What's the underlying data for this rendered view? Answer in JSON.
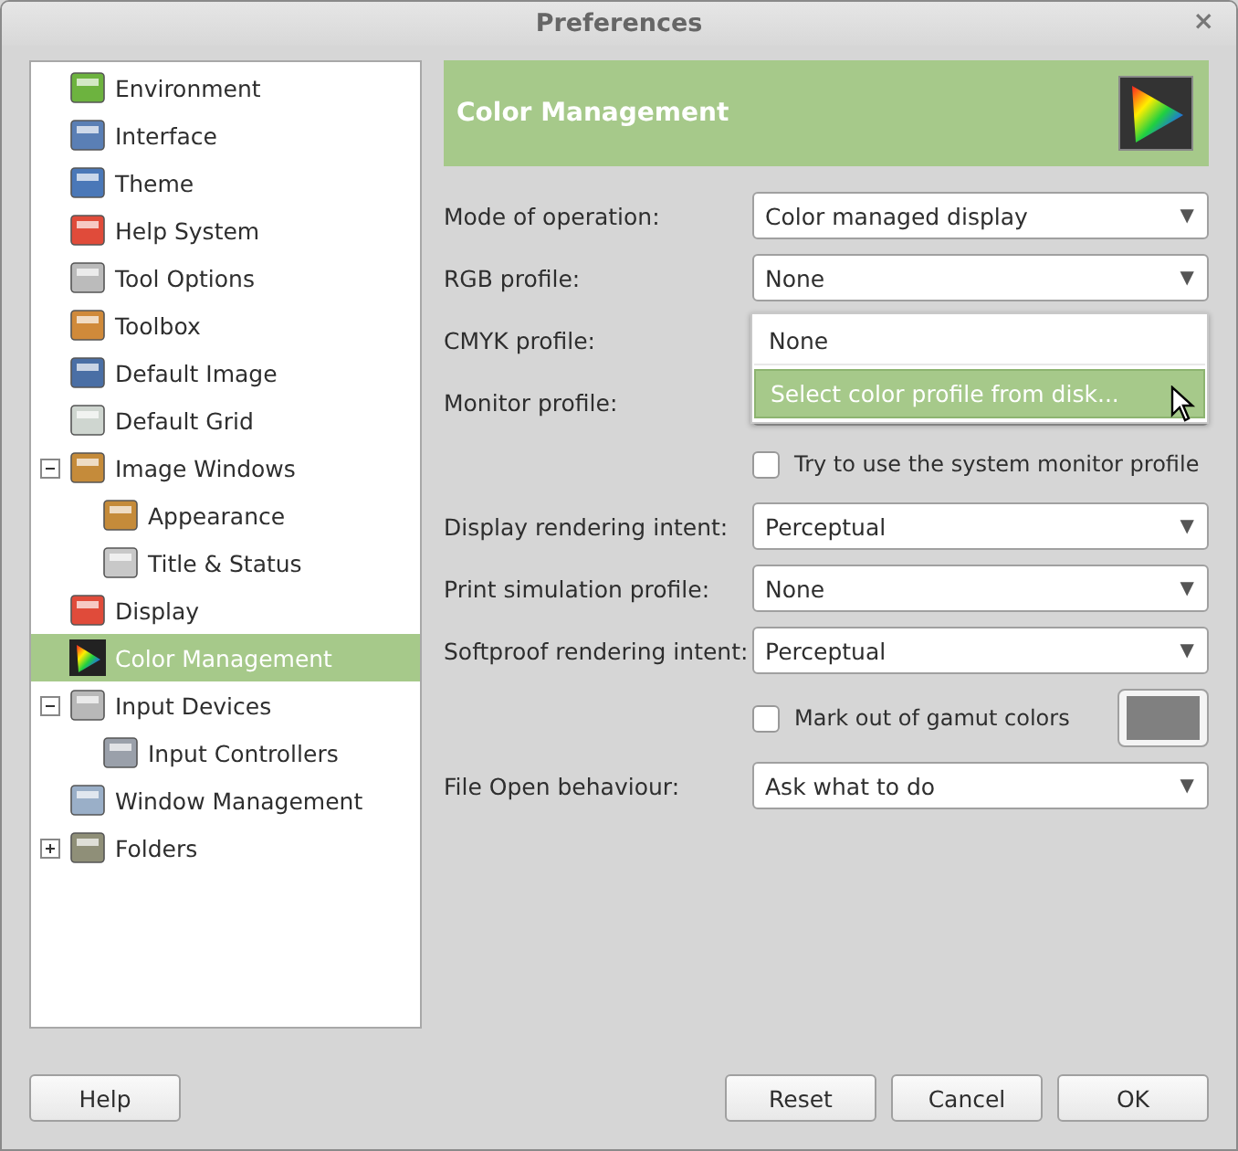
{
  "window": {
    "title": "Preferences",
    "close": "×"
  },
  "tree": [
    {
      "label": "Environment",
      "selected": false
    },
    {
      "label": "Interface",
      "selected": false
    },
    {
      "label": "Theme",
      "selected": false
    },
    {
      "label": "Help System",
      "selected": false
    },
    {
      "label": "Tool Options",
      "selected": false
    },
    {
      "label": "Toolbox",
      "selected": false
    },
    {
      "label": "Default Image",
      "selected": false
    },
    {
      "label": "Default Grid",
      "selected": false
    },
    {
      "label": "Image Windows",
      "selected": false,
      "expanded": true,
      "children": [
        {
          "label": "Appearance",
          "selected": false
        },
        {
          "label": "Title & Status",
          "selected": false
        }
      ]
    },
    {
      "label": "Display",
      "selected": false
    },
    {
      "label": "Color Management",
      "selected": true
    },
    {
      "label": "Input Devices",
      "selected": false,
      "expanded": true,
      "children": [
        {
          "label": "Input Controllers",
          "selected": false
        }
      ]
    },
    {
      "label": "Window Management",
      "selected": false
    },
    {
      "label": "Folders",
      "selected": false,
      "expanded": false
    }
  ],
  "header": {
    "title": "Color Management"
  },
  "rows": [
    {
      "kind": "combo",
      "label": "Mode of operation:",
      "value": "Color managed display",
      "arrow": "▼"
    },
    {
      "kind": "combo",
      "label": "RGB profile:",
      "value": "None",
      "arrow": "▼"
    },
    {
      "kind": "combo",
      "label": "CMYK profile:",
      "popup": [
        {
          "label": "None",
          "selected": false
        },
        {
          "label": "Select color profile from disk...",
          "selected": true
        }
      ]
    },
    {
      "kind": "combo",
      "label": "Monitor profile:"
    },
    {
      "kind": "checkbox",
      "label": "Try to use the system monitor profile",
      "checked": false
    },
    {
      "kind": "combo",
      "label": "Display rendering intent:",
      "value": "Perceptual",
      "arrow": "▼"
    },
    {
      "kind": "combo",
      "label": "Print simulation profile:",
      "value": "None",
      "arrow": "▼"
    },
    {
      "kind": "combo",
      "label": "Softproof rendering intent:",
      "value": "Perceptual",
      "arrow": "▼"
    },
    {
      "kind": "checkbox_color",
      "label": "Mark out of gamut colors",
      "checked": false,
      "color": "#808080"
    },
    {
      "kind": "combo",
      "label": "File Open behaviour:",
      "value": "Ask what to do",
      "arrow": "▼"
    }
  ],
  "buttons": {
    "left": [
      "Help"
    ],
    "right": [
      "Reset",
      "Cancel",
      "OK"
    ]
  }
}
